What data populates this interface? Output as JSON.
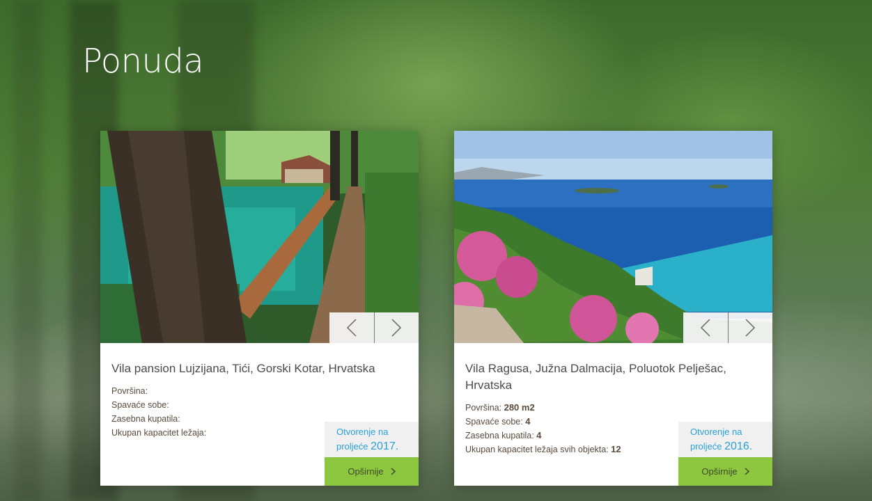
{
  "section": {
    "title": "Ponuda"
  },
  "cards": [
    {
      "title": "Vila pansion Lujzijana, Tići, Gorski Kotar, Hrvatska",
      "specs": {
        "area_label": "Površina:",
        "area_value": "",
        "bedrooms_label": "Spavaće sobe:",
        "bedrooms_value": "",
        "bathrooms_label": "Zasebna kupatila:",
        "bathrooms_value": "",
        "capacity_label": "Ukupan kapacitet ležaja:",
        "capacity_value": ""
      },
      "opening": {
        "text": "Otvorenje na",
        "season": "proljeće",
        "year": "2017."
      },
      "more_label": "Opširnije",
      "image": "forest-lake-boardwalk"
    },
    {
      "title": "Vila Ragusa, Južna Dalmacija, Poluotok Pelješac, Hrvatska",
      "specs": {
        "area_label": "Površina:",
        "area_value": "280 m2",
        "bedrooms_label": "Spavaće sobe:",
        "bedrooms_value": "4",
        "bathrooms_label": "Zasebna kupatila:",
        "bathrooms_value": "4",
        "capacity_label": "Ukupan kapacitet ležaja svih objekta:",
        "capacity_value": "12"
      },
      "opening": {
        "text": "Otvorenje na",
        "season": "proljeće",
        "year": "2016."
      },
      "more_label": "Opširnije",
      "image": "adriatic-coast-flowers"
    }
  ],
  "colors": {
    "accent_green": "#8dc63f",
    "link_blue": "#2a9fd6",
    "text_dark": "#4a4a4a"
  },
  "icons": {
    "prev": "chevron-left-icon",
    "next": "chevron-right-icon",
    "more": "chevron-right-icon"
  }
}
